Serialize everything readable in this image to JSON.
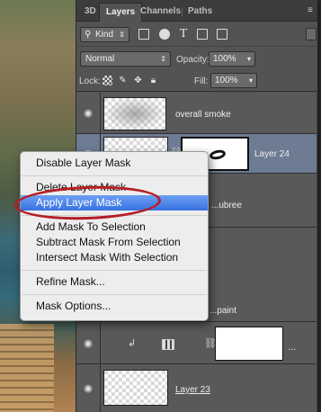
{
  "tabs": [
    {
      "label": "3D"
    },
    {
      "label": "Layers",
      "active": true
    },
    {
      "label": "Channels"
    },
    {
      "label": "Paths"
    }
  ],
  "filter": {
    "kind_label": "Kind",
    "icons": [
      "image-filter-icon",
      "adjustment-filter-icon",
      "type-filter-icon",
      "shape-filter-icon",
      "smart-object-filter-icon"
    ]
  },
  "blend": {
    "mode": "Normal",
    "opacity_label": "Opacity:",
    "opacity_value": "100%",
    "fill_label": "Fill:",
    "fill_value": "100%"
  },
  "lock": {
    "label": "Lock:",
    "icons": [
      "lock-transparent-icon",
      "lock-image-icon",
      "lock-position-icon",
      "lock-all-icon"
    ]
  },
  "layers": [
    {
      "name": "overall smoke"
    },
    {
      "name": "Layer 24"
    },
    {
      "name": "...ubree"
    },
    {
      "name": "...paint"
    },
    {
      "name": ""
    },
    {
      "name": "Layer 23"
    }
  ],
  "context_menu": {
    "items": [
      {
        "label": "Disable Layer Mask"
      },
      {
        "label": "Delete Layer Mask"
      },
      {
        "label": "Apply Layer Mask",
        "highlighted": true
      },
      {
        "label": "Add Mask To Selection"
      },
      {
        "label": "Subtract Mask From Selection"
      },
      {
        "label": "Intersect Mask With Selection"
      },
      {
        "label": "Refine Mask..."
      },
      {
        "label": "Mask Options..."
      }
    ]
  },
  "colors": {
    "highlight": "#3671e0",
    "annotation": "#b51e25",
    "panel_bg": "#535353",
    "selected_row": "#6d7c93"
  }
}
